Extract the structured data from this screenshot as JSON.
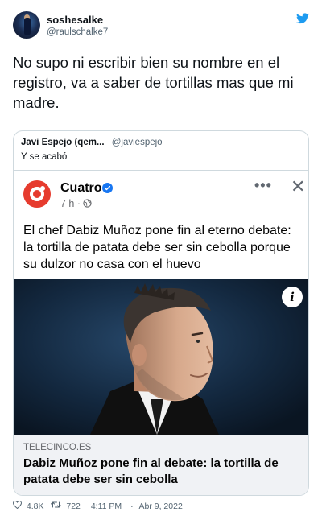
{
  "author": {
    "name": "soshesalke",
    "handle": "@raulschalke7"
  },
  "tweet_text": "No supo ni escribir bien su nombre en el registro, va a saber de tortillas mas que mi madre.",
  "quoted": {
    "name": "Javi Espejo (qem...",
    "handle": "@javiespejo",
    "text": "Y se acabó"
  },
  "facebook_post": {
    "page_name": "Cuatro",
    "time": "7 h ·",
    "text": "El chef Dabiz Muñoz pone fin al eterno debate: la tortilla de patata debe ser sin cebolla porque su dulzor no casa con el huevo",
    "more_label": "•••",
    "close_label": "✕",
    "info_label": "i",
    "link_domain": "TELECINCO.ES",
    "link_title": "Dabiz Muñoz pone fin al debate: la tortilla de patata debe ser sin cebolla"
  },
  "footer": {
    "likes": "4.8K",
    "retweets": "722",
    "time": "4:11 PM",
    "separator": "·",
    "date": "Abr 9, 2022"
  },
  "colors": {
    "twitter_blue": "#1d9bf0",
    "cuatro_red": "#e63b2e",
    "facebook_verified": "#1877f2",
    "muted_text": "#536471"
  }
}
